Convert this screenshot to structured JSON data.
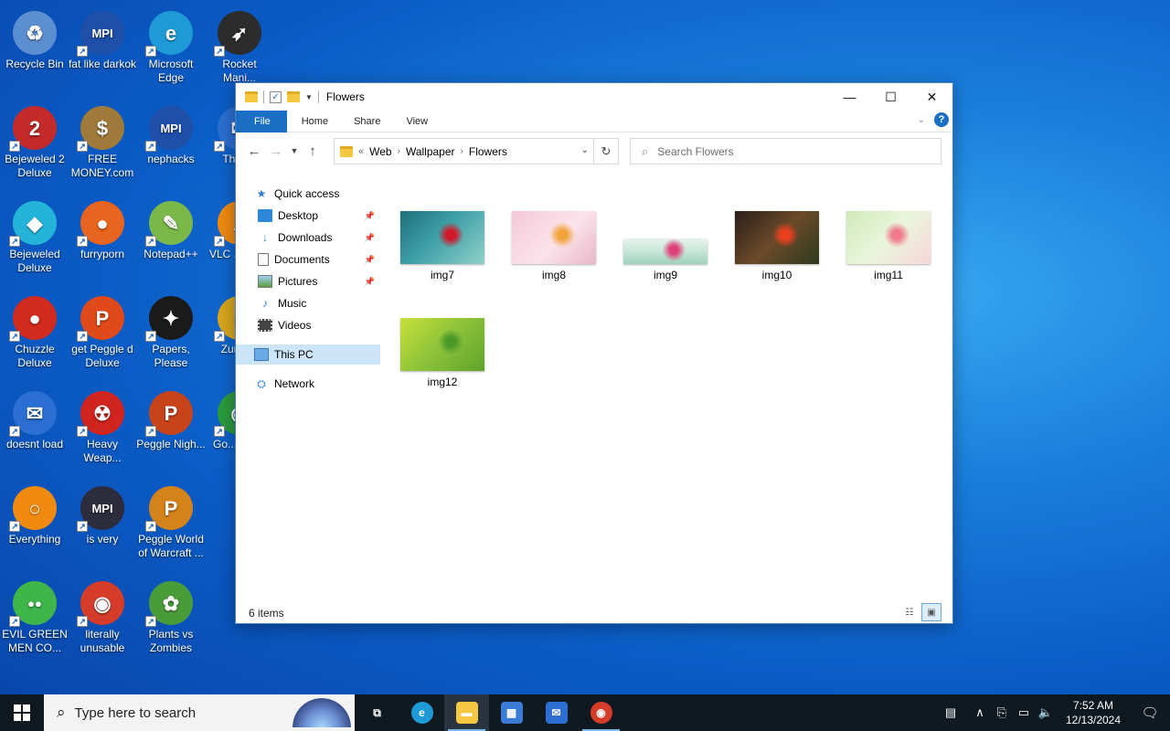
{
  "desktop": {
    "icons": [
      {
        "label": "Recycle Bin",
        "glyph": "♻",
        "color": "#5b8fd1"
      },
      {
        "label": "fat like darkok",
        "glyph": "MPI",
        "color": "#1f4fa8"
      },
      {
        "label": "Microsoft Edge",
        "glyph": "e",
        "color": "#1e9bd7"
      },
      {
        "label": "Rocket Mani...",
        "glyph": "➶",
        "color": "#2c2c2c"
      },
      {
        "label": "Bejeweled 2 Deluxe",
        "glyph": "2",
        "color": "#c42a2a"
      },
      {
        "label": "FREE MONEY.com",
        "glyph": "$",
        "color": "#a07a3a"
      },
      {
        "label": "nephacks",
        "glyph": "MPI",
        "color": "#1f4fa8"
      },
      {
        "label": "Thun...",
        "glyph": "✉",
        "color": "#2a6fd1"
      },
      {
        "label": "Bejeweled Deluxe",
        "glyph": "◆",
        "color": "#25b4d9"
      },
      {
        "label": "furryporn",
        "glyph": "●",
        "color": "#e8641f"
      },
      {
        "label": "Notepad++",
        "glyph": "✎",
        "color": "#7bb84a"
      },
      {
        "label": "VLC ... pla...",
        "glyph": "▲",
        "color": "#f08a10"
      },
      {
        "label": "Chuzzle Deluxe",
        "glyph": "●",
        "color": "#d12a1e"
      },
      {
        "label": "get Peggle d Deluxe",
        "glyph": "P",
        "color": "#e04a1a"
      },
      {
        "label": "Papers, Please",
        "glyph": "✦",
        "color": "#1a1a1a"
      },
      {
        "label": "Zuma...",
        "glyph": "●",
        "color": "#d9a61e"
      },
      {
        "label": "doesnt load",
        "glyph": "✉",
        "color": "#2a6fd1"
      },
      {
        "label": "Heavy Weap...",
        "glyph": "☢",
        "color": "#d0241e"
      },
      {
        "label": "Peggle Nigh...",
        "glyph": "P",
        "color": "#c8431a"
      },
      {
        "label": "Go... Chr...",
        "glyph": "◉",
        "color": "#2c9a3d"
      },
      {
        "label": "Everything",
        "glyph": "○",
        "color": "#f08a10"
      },
      {
        "label": "is very",
        "glyph": "MPI",
        "color": "#2c2c3c"
      },
      {
        "label": "Peggle World of Warcraft ...",
        "glyph": "P",
        "color": "#d4821a"
      },
      {
        "label": "EVIL GREEN MEN CO...",
        "glyph": "●●",
        "color": "#3fb54a"
      },
      {
        "label": "literally unusable",
        "glyph": "◉",
        "color": "#d63c2a"
      },
      {
        "label": "Plants vs Zombies",
        "glyph": "✿",
        "color": "#4a9c3a"
      }
    ]
  },
  "window": {
    "title": "Flowers",
    "buttons": {
      "minimize": "—",
      "maximize": "☐",
      "close": "✕"
    },
    "ribbon_tabs": [
      "File",
      "Home",
      "Share",
      "View"
    ],
    "help": "?",
    "address": {
      "parts": [
        "Web",
        "Wallpaper",
        "Flowers"
      ],
      "overflow": "«"
    },
    "search_placeholder": "Search Flowers",
    "nav": [
      {
        "label": "Quick access",
        "icon": "star-icon",
        "pinned": false
      },
      {
        "label": "Desktop",
        "icon": "desktop-icon",
        "pinned": true
      },
      {
        "label": "Downloads",
        "icon": "download-icon",
        "pinned": true
      },
      {
        "label": "Documents",
        "icon": "document-icon",
        "pinned": true
      },
      {
        "label": "Pictures",
        "icon": "pictures-icon",
        "pinned": true
      },
      {
        "label": "Music",
        "icon": "music-icon",
        "pinned": false
      },
      {
        "label": "Videos",
        "icon": "video-icon",
        "pinned": false
      },
      {
        "label": "This PC",
        "icon": "computer-icon",
        "pinned": false,
        "selected": true
      },
      {
        "label": "Network",
        "icon": "network-icon",
        "pinned": false
      }
    ],
    "files": [
      {
        "name": "img7",
        "gradient": "linear-gradient(135deg,#1e6f7a 0%,#3fa0a8 45%,#8fd0c8 100%)",
        "accent": "#d0182a"
      },
      {
        "name": "img8",
        "gradient": "linear-gradient(135deg,#f4c9d6 0%,#fbe3ea 55%,#e9b8c8 100%)",
        "accent": "#f2a43a"
      },
      {
        "name": "img9",
        "gradient": "linear-gradient(180deg,#e8f3ee 0%,#bfe3d2 60%,#9ed2bd 100%)",
        "accent": "#e0407a"
      },
      {
        "name": "img10",
        "gradient": "linear-gradient(135deg,#2a1f1a 0%,#6b4a2a 50%,#2d3a1e 100%)",
        "accent": "#e8401e"
      },
      {
        "name": "img11",
        "gradient": "linear-gradient(135deg,#cfe9b8 0%,#eaf6dc 50%,#f6d6d8 100%)",
        "accent": "#f07a8a"
      },
      {
        "name": "img12",
        "gradient": "linear-gradient(135deg,#c8e03a 0%,#8dc23a 50%,#5fa32a 100%)",
        "accent": "#4a9a2a"
      }
    ],
    "status": "6 items"
  },
  "taskbar": {
    "search_placeholder": "Type here to search",
    "time": "7:52 AM",
    "date": "12/13/2024",
    "apps": [
      {
        "name": "task-view",
        "glyph": "⧉",
        "color": "transparent"
      },
      {
        "name": "edge",
        "glyph": "e",
        "color": "#1e9bd7"
      },
      {
        "name": "file-explorer",
        "glyph": "▬",
        "color": "#f5c842"
      },
      {
        "name": "store",
        "glyph": "▦",
        "color": "#3a7bd5"
      },
      {
        "name": "mail",
        "glyph": "✉",
        "color": "#2a6fd1"
      },
      {
        "name": "chrome",
        "glyph": "◉",
        "color": "#d63c2a"
      }
    ]
  }
}
